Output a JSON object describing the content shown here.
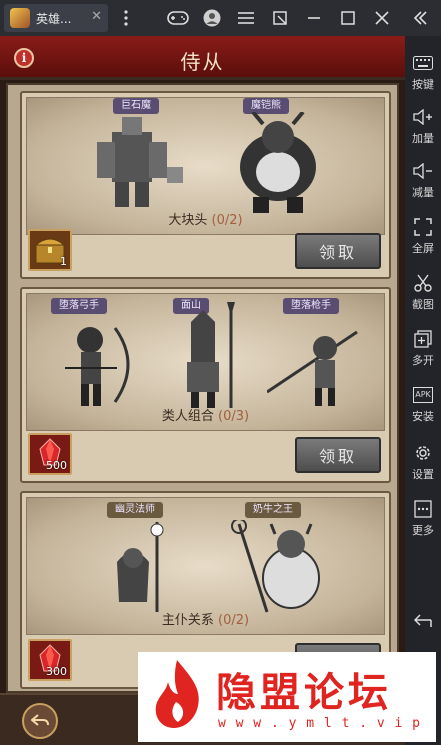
{
  "window": {
    "tab_title": "英雄...",
    "tab_close": "✕"
  },
  "sidebar": {
    "items": [
      {
        "icon": "keyboard-icon",
        "label": "按键"
      },
      {
        "icon": "volume-up-icon",
        "label": "加量"
      },
      {
        "icon": "volume-down-icon",
        "label": "减量"
      },
      {
        "icon": "fullscreen-icon",
        "label": "全屏"
      },
      {
        "icon": "scissors-icon",
        "label": "截图"
      },
      {
        "icon": "multi-open-icon",
        "label": "多开"
      },
      {
        "icon": "apk-icon",
        "label": "安装",
        "icon_text": "APK"
      },
      {
        "icon": "gear-icon",
        "label": "设置"
      },
      {
        "icon": "more-icon",
        "label": "更多"
      }
    ]
  },
  "game": {
    "title": "侍从",
    "info_icon": "i",
    "claim_label": "领取",
    "groups": [
      {
        "name": "大块头",
        "progress": "(0/2)",
        "members": [
          "巨石魔",
          "魔铠熊"
        ],
        "reward_icon": "treasure-chest-icon",
        "reward_qty": "1"
      },
      {
        "name": "类人组合",
        "progress": "(0/3)",
        "members": [
          "堕落弓手",
          "面山",
          "堕落枪手"
        ],
        "reward_icon": "red-gem-icon",
        "reward_qty": "500"
      },
      {
        "name": "主仆关系",
        "progress": "(0/2)",
        "members": [
          "幽灵法师",
          "奶牛之王"
        ],
        "reward_icon": "red-gem-icon",
        "reward_qty": "300"
      }
    ]
  },
  "watermark": {
    "text": "隐盟论坛",
    "url": "w w w . y m l t . v i p"
  },
  "colors": {
    "header_red": "#8a1c18",
    "badge_purple": "#5a4d72",
    "watermark_red": "#e0241f"
  }
}
